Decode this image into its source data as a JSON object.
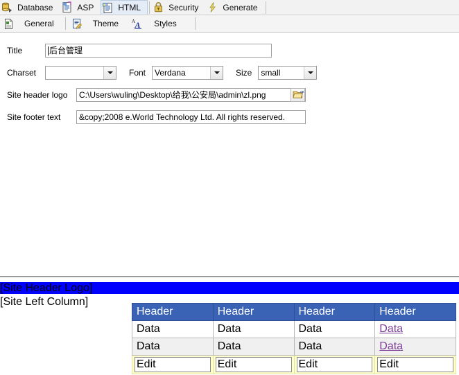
{
  "toolbar": {
    "modules": [
      {
        "label": "Database",
        "icon": "database-icon",
        "active": false
      },
      {
        "label": "ASP",
        "icon": "asp-page-icon",
        "active": false
      },
      {
        "label": "HTML",
        "icon": "html-page-icon",
        "active": true
      },
      {
        "label": "Security",
        "icon": "lock-icon",
        "active": false
      },
      {
        "label": "Generate",
        "icon": "lightning-icon",
        "active": false
      }
    ],
    "subtabs": [
      {
        "label": "General",
        "icon": "document-icon",
        "active": true
      },
      {
        "label": "Theme",
        "icon": "theme-page-icon",
        "active": false
      },
      {
        "label": "Styles",
        "icon": "font-style-icon",
        "active": false
      }
    ]
  },
  "form": {
    "title": {
      "label": "Title",
      "value": "后台管理"
    },
    "charset": {
      "label": "Charset",
      "value": "",
      "options": [
        ""
      ]
    },
    "font": {
      "label": "Font",
      "value": "Verdana",
      "options": [
        "Verdana"
      ]
    },
    "size": {
      "label": "Size",
      "value": "small",
      "options": [
        "small"
      ]
    },
    "header_logo": {
      "label": "Site header logo",
      "value": "C:\\Users\\wuling\\Desktop\\给我\\公安局\\admin\\zl.png",
      "browse_icon": "open-folder-icon"
    },
    "footer_text": {
      "label": "Site footer text",
      "value": "&copy;2008 e.World Technology Ltd. All rights reserved."
    }
  },
  "preview": {
    "header_logo_placeholder": "[Site Header Logo]",
    "left_column_placeholder": "[Site Left Column]",
    "header_bar_color": "#0000FF",
    "table": {
      "headers": [
        "Header",
        "Header",
        "Header",
        "Header"
      ],
      "rows": [
        {
          "cells": [
            "Data",
            "Data",
            "Data",
            "Data"
          ],
          "link_cols": [
            3
          ]
        },
        {
          "cells": [
            "Data",
            "Data",
            "Data",
            "Data"
          ],
          "link_cols": [
            3
          ]
        }
      ],
      "edit_row": [
        "Edit",
        "Edit",
        "Edit",
        "Edit"
      ],
      "header_bg": "#3A62B5",
      "link_color": "#7A3C96",
      "edit_bg": "#FFFFCC"
    }
  }
}
